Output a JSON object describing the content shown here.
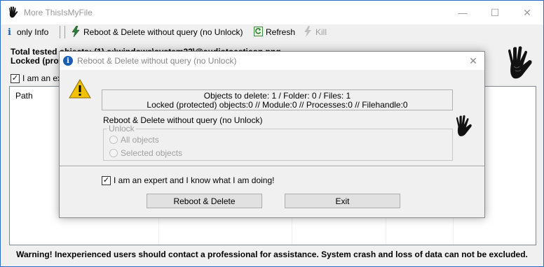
{
  "window": {
    "title": "More ThisIsMyFile",
    "icon": "hand-icon",
    "minimize": "—",
    "maximize": "☐",
    "close": "✕"
  },
  "toolbar": {
    "only_info": "only Info",
    "reboot_delete": "Reboot & Delete without query (no Unlock)",
    "refresh": "Refresh",
    "kill": "Kill"
  },
  "info": {
    "line1": "Total tested objects: (1) c:\\windows\\system32\\@audiotoasticon.png",
    "line2": "Locked (protected) objects:0"
  },
  "expert_checkbox": {
    "label": "I am an expert and I know what I am doing!",
    "checked": true
  },
  "list": {
    "column_path": "Path"
  },
  "warning": "Warning! Inexperienced users should contact a professional for assistance. System crash and loss of data can not be excluded.",
  "dialog": {
    "title": "Reboot & Delete without query (no Unlock)",
    "close": "✕",
    "summary_line1": "Objects to delete: 1 / Folder: 0 / Files: 1",
    "summary_line2": "Locked (protected) objects:0  //  Module:0  //  Processes:0  //  Filehandle:0",
    "mode_label": "Reboot & Delete without query (no Unlock)",
    "unlock_group": "Unlock",
    "radio_all": "All objects",
    "radio_selected": "Selected objects",
    "expert_label": "I am an expert and I know what I am doing!",
    "expert_checked": true,
    "reboot_button": "Reboot & Delete",
    "exit_button": "Exit"
  },
  "colors": {
    "border_accent": "#2b6cc9",
    "info_icon": "#1a5fb4",
    "warning_icon": "#f2c200"
  }
}
